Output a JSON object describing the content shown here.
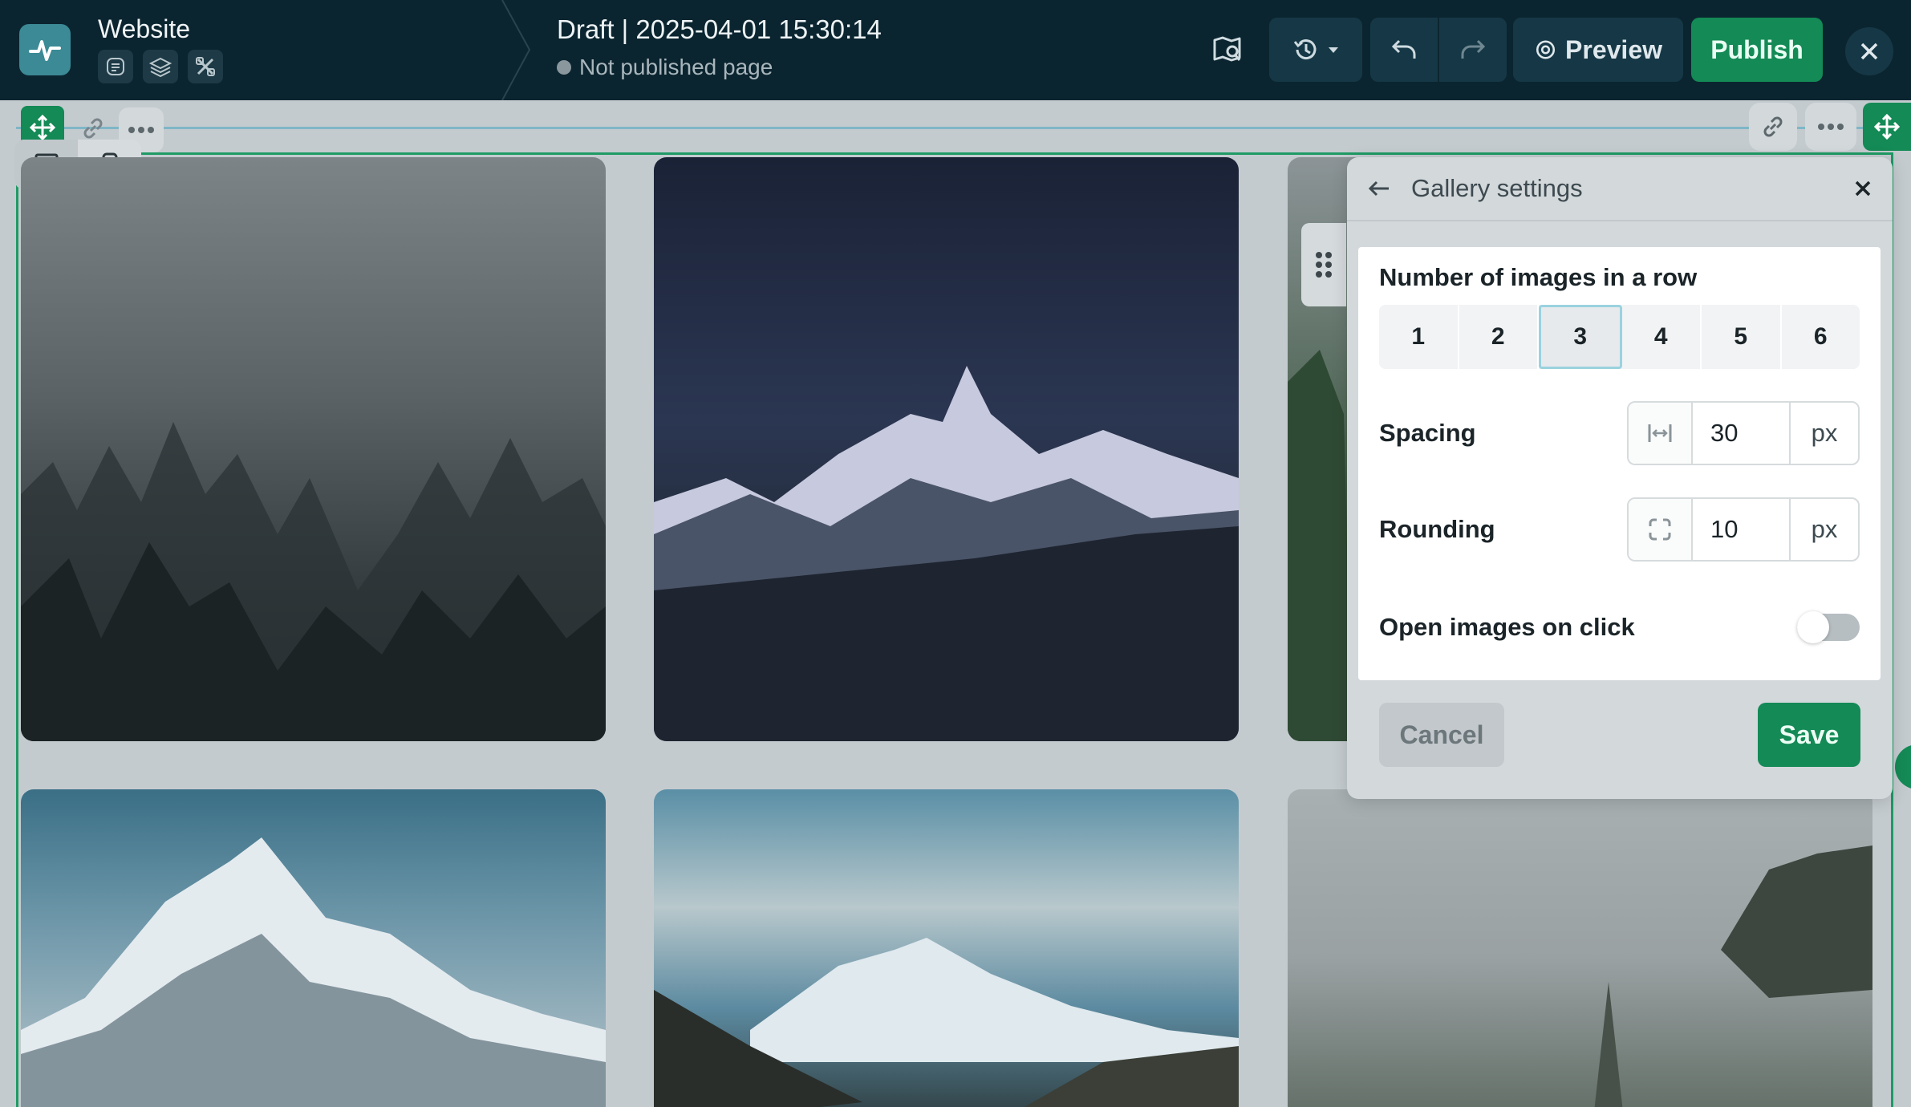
{
  "topbar": {
    "site_title": "Website",
    "draft_title": "Draft | 2025-04-01 15:30:14",
    "draft_status": "Not published page",
    "preview_label": "Preview",
    "publish_label": "Publish",
    "icons": [
      "pulse-logo-icon",
      "document-icon",
      "layers-icon",
      "tools-icon",
      "map-search-icon",
      "history-icon",
      "chevron-down-icon",
      "undo-icon",
      "redo-icon",
      "eye-icon",
      "close-icon"
    ],
    "colors": {
      "background": "#0b2530",
      "publish": "#148a56"
    }
  },
  "canvas": {
    "device_modes": [
      "desktop-icon",
      "mobile-icon"
    ],
    "active_device": "desktop",
    "photos": [
      "misty-forest",
      "starry-mountain",
      "green-forest",
      "snow-peak",
      "mountain-road",
      "foggy-trees"
    ]
  },
  "gallery_settings": {
    "title": "Gallery settings",
    "row_count_label": "Number of images in a row",
    "row_count_options": [
      "1",
      "2",
      "3",
      "4",
      "5",
      "6"
    ],
    "row_count_selected": "3",
    "spacing_label": "Spacing",
    "spacing_value": "30",
    "spacing_unit": "px",
    "rounding_label": "Rounding",
    "rounding_value": "10",
    "rounding_unit": "px",
    "open_on_click_label": "Open images on click",
    "open_on_click": false,
    "cancel_label": "Cancel",
    "save_label": "Save"
  }
}
